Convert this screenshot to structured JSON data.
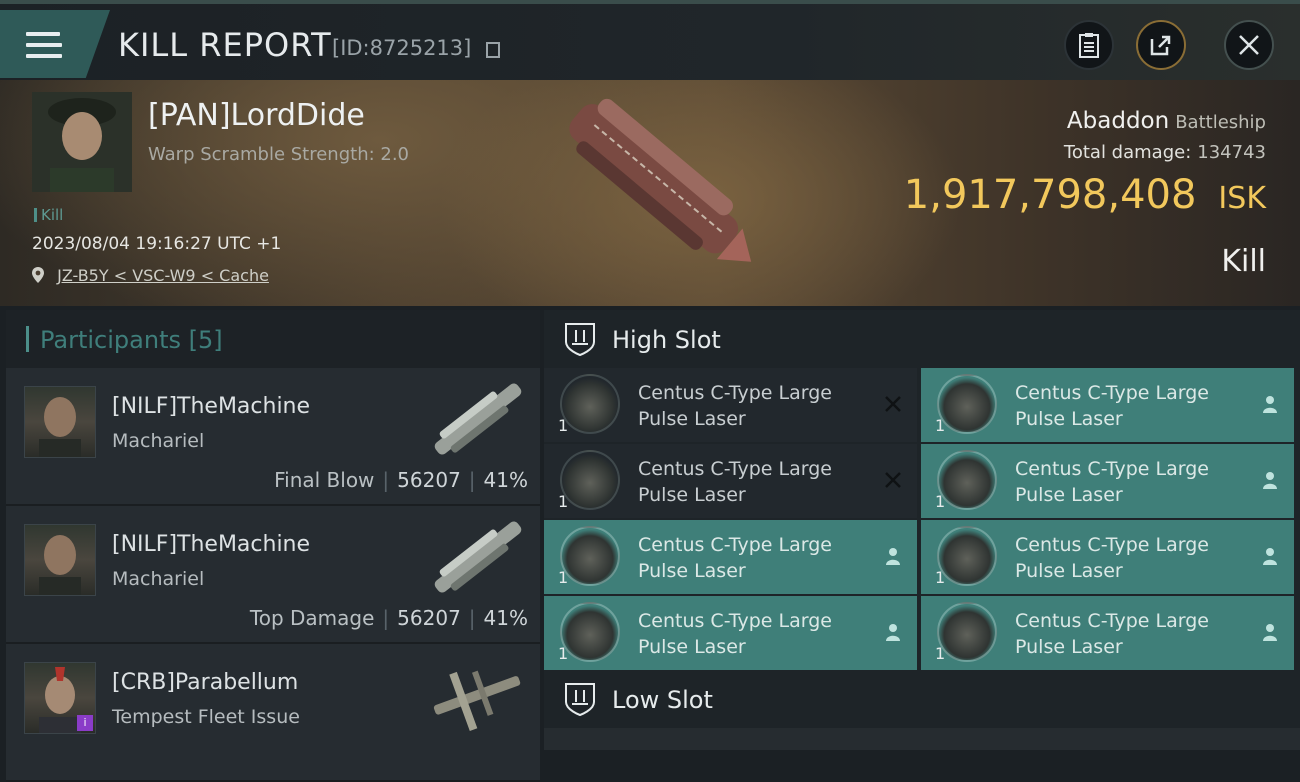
{
  "header": {
    "title": "KILL REPORT",
    "id_text": "[ID:8725213]"
  },
  "victim": {
    "name": "[PAN]LordDide",
    "scramble": "Warp Scramble Strength: 2.0",
    "kill_tag": "Kill",
    "timestamp": "2023/08/04 19:16:27 UTC +1",
    "location": "JZ-B5Y < VSC-W9 < Cache",
    "ship_name": "Abaddon",
    "ship_class": "Battleship",
    "total_damage_label": "Total damage:",
    "total_damage": "134743",
    "isk_value": "1,917,798,408",
    "isk_unit": "ISK",
    "result": "Kill"
  },
  "participants": {
    "label": "Participants",
    "count": "[5]",
    "rows": [
      {
        "name": "[NILF]TheMachine",
        "ship": "Machariel",
        "role": "Final Blow",
        "damage": "56207",
        "percent": "41%"
      },
      {
        "name": "[NILF]TheMachine",
        "ship": "Machariel",
        "role": "Top Damage",
        "damage": "56207",
        "percent": "41%"
      },
      {
        "name": "[CRB]Parabellum",
        "ship": "Tempest Fleet Issue",
        "role": "",
        "damage": "",
        "percent": ""
      }
    ]
  },
  "slots": {
    "high_label": "High Slot",
    "low_label": "Low Slot",
    "module_line1": "Centus C-Type Large",
    "module_line2": "Pulse Laser",
    "qty": "1",
    "modules": [
      {
        "state": "destroyed"
      },
      {
        "state": "dropped"
      },
      {
        "state": "destroyed"
      },
      {
        "state": "dropped"
      },
      {
        "state": "dropped"
      },
      {
        "state": "dropped"
      },
      {
        "state": "dropped"
      },
      {
        "state": "dropped"
      }
    ]
  },
  "colors": {
    "accent_teal": "#3f7f79",
    "isk_gold": "#f2c85c"
  }
}
